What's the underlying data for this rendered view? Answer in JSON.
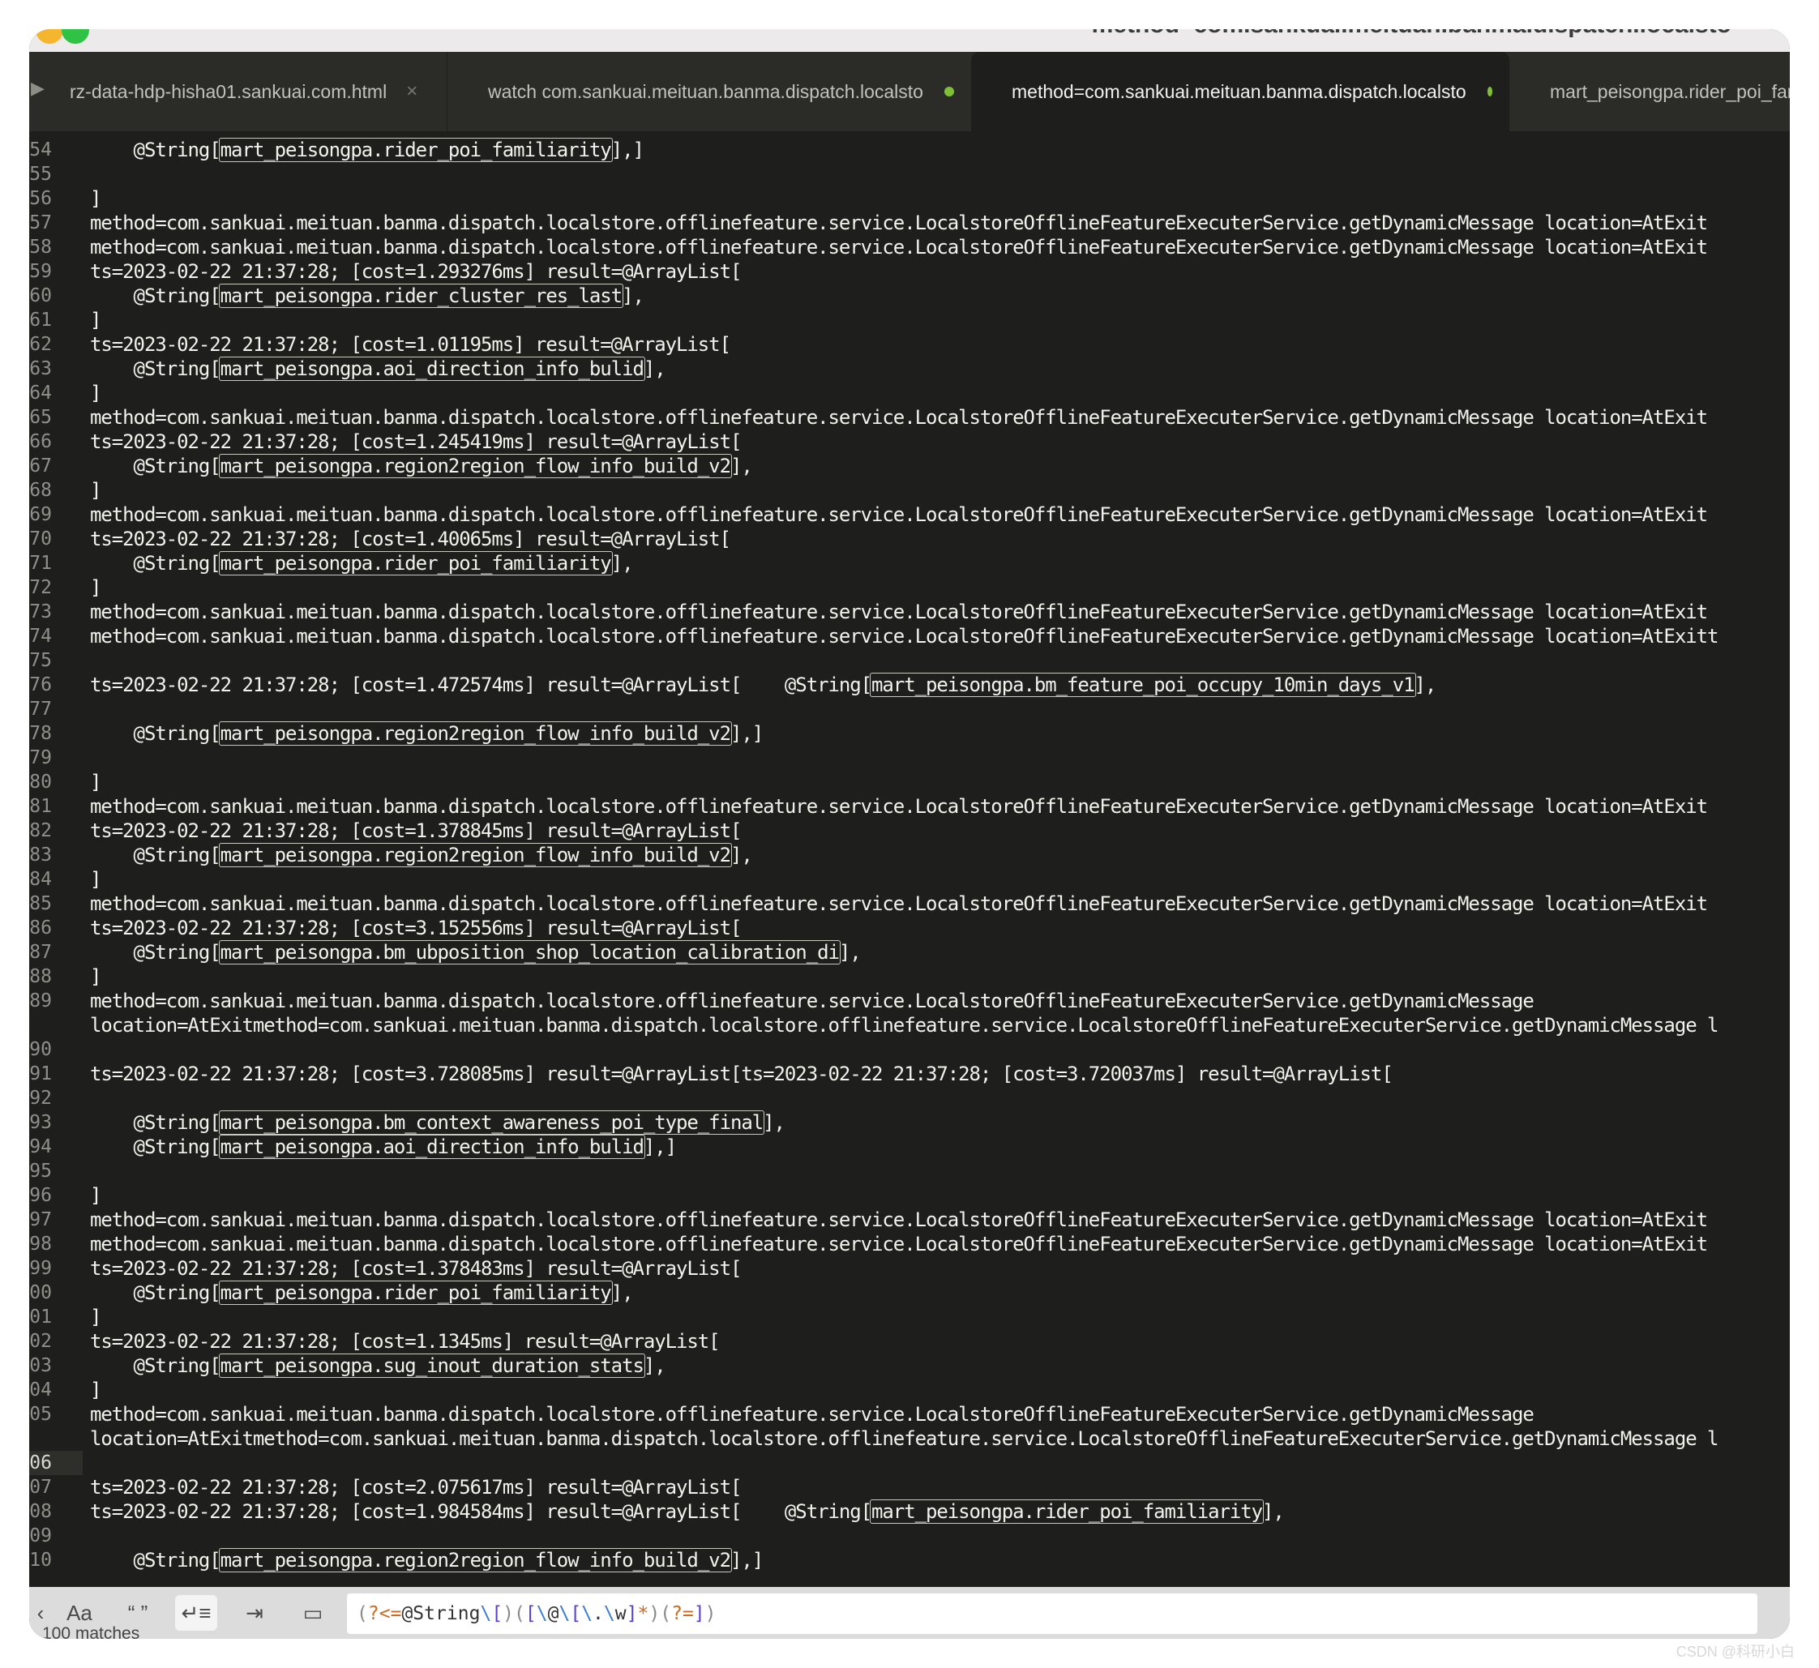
{
  "window_title": "method=com.sankuai.meituan.banma.dispatch.localsto",
  "tabs": [
    {
      "label": "rz-data-hdp-hisha01.sankuai.com.html",
      "active": false,
      "indicator": "close"
    },
    {
      "label": "watch com.sankuai.meituan.banma.dispatch.localsto",
      "active": false,
      "indicator": "dot"
    },
    {
      "label": "method=com.sankuai.meituan.banma.dispatch.localsto",
      "active": true,
      "indicator": "dot"
    },
    {
      "label": "mart_peisongpa.rider_poi_fami",
      "active": false,
      "indicator": "none"
    }
  ],
  "lines": [
    {
      "num": "54",
      "parts": [
        {
          "t": "    @String["
        },
        {
          "t": "mart_peisongpa.rider_poi_familiarity",
          "m": true
        },
        {
          "t": "],]"
        }
      ]
    },
    {
      "num": "55",
      "parts": []
    },
    {
      "num": "56",
      "parts": [
        {
          "t": "]"
        }
      ]
    },
    {
      "num": "57",
      "parts": [
        {
          "t": "method=com.sankuai.meituan.banma.dispatch.localstore.offlinefeature.service.LocalstoreOfflineFeatureExecuterService.getDynamicMessage location=AtExit"
        }
      ]
    },
    {
      "num": "58",
      "parts": [
        {
          "t": "method=com.sankuai.meituan.banma.dispatch.localstore.offlinefeature.service.LocalstoreOfflineFeatureExecuterService.getDynamicMessage location=AtExit"
        }
      ]
    },
    {
      "num": "59",
      "parts": [
        {
          "t": "ts=2023-02-22 21:37:28; [cost=1.293276ms] result=@ArrayList["
        }
      ]
    },
    {
      "num": "60",
      "parts": [
        {
          "t": "    @String["
        },
        {
          "t": "mart_peisongpa.rider_cluster_res_last",
          "m": true
        },
        {
          "t": "],"
        }
      ]
    },
    {
      "num": "61",
      "parts": [
        {
          "t": "]"
        }
      ]
    },
    {
      "num": "62",
      "parts": [
        {
          "t": "ts=2023-02-22 21:37:28; [cost=1.01195ms] result=@ArrayList["
        }
      ]
    },
    {
      "num": "63",
      "parts": [
        {
          "t": "    @String["
        },
        {
          "t": "mart_peisongpa.aoi_direction_info_bulid",
          "m": true
        },
        {
          "t": "],"
        }
      ]
    },
    {
      "num": "64",
      "parts": [
        {
          "t": "]"
        }
      ]
    },
    {
      "num": "65",
      "parts": [
        {
          "t": "method=com.sankuai.meituan.banma.dispatch.localstore.offlinefeature.service.LocalstoreOfflineFeatureExecuterService.getDynamicMessage location=AtExit"
        }
      ]
    },
    {
      "num": "66",
      "parts": [
        {
          "t": "ts=2023-02-22 21:37:28; [cost=1.245419ms] result=@ArrayList["
        }
      ]
    },
    {
      "num": "67",
      "parts": [
        {
          "t": "    @String["
        },
        {
          "t": "mart_peisongpa.region2region_flow_info_build_v2",
          "m": true
        },
        {
          "t": "],"
        }
      ]
    },
    {
      "num": "68",
      "parts": [
        {
          "t": "]"
        }
      ]
    },
    {
      "num": "69",
      "parts": [
        {
          "t": "method=com.sankuai.meituan.banma.dispatch.localstore.offlinefeature.service.LocalstoreOfflineFeatureExecuterService.getDynamicMessage location=AtExit"
        }
      ]
    },
    {
      "num": "70",
      "parts": [
        {
          "t": "ts=2023-02-22 21:37:28; [cost=1.40065ms] result=@ArrayList["
        }
      ]
    },
    {
      "num": "71",
      "parts": [
        {
          "t": "    @String["
        },
        {
          "t": "mart_peisongpa.rider_poi_familiarity",
          "m": true
        },
        {
          "t": "],"
        }
      ]
    },
    {
      "num": "72",
      "parts": [
        {
          "t": "]"
        }
      ]
    },
    {
      "num": "73",
      "parts": [
        {
          "t": "method=com.sankuai.meituan.banma.dispatch.localstore.offlinefeature.service.LocalstoreOfflineFeatureExecuterService.getDynamicMessage location=AtExit"
        }
      ]
    },
    {
      "num": "74",
      "parts": [
        {
          "t": "method=com.sankuai.meituan.banma.dispatch.localstore.offlinefeature.service.LocalstoreOfflineFeatureExecuterService.getDynamicMessage location=AtExitt"
        }
      ]
    },
    {
      "num": "75",
      "parts": []
    },
    {
      "num": "76",
      "parts": [
        {
          "t": "ts=2023-02-22 21:37:28; [cost=1.472574ms] result=@ArrayList[    @String["
        },
        {
          "t": "mart_peisongpa.bm_feature_poi_occupy_10min_days_v1",
          "m": true
        },
        {
          "t": "],"
        }
      ]
    },
    {
      "num": "77",
      "parts": []
    },
    {
      "num": "78",
      "parts": [
        {
          "t": "    @String["
        },
        {
          "t": "mart_peisongpa.region2region_flow_info_build_v2",
          "m": true
        },
        {
          "t": "],]"
        }
      ]
    },
    {
      "num": "79",
      "parts": []
    },
    {
      "num": "80",
      "parts": [
        {
          "t": "]"
        }
      ]
    },
    {
      "num": "81",
      "parts": [
        {
          "t": "method=com.sankuai.meituan.banma.dispatch.localstore.offlinefeature.service.LocalstoreOfflineFeatureExecuterService.getDynamicMessage location=AtExit"
        }
      ]
    },
    {
      "num": "82",
      "parts": [
        {
          "t": "ts=2023-02-22 21:37:28; [cost=1.378845ms] result=@ArrayList["
        }
      ]
    },
    {
      "num": "83",
      "parts": [
        {
          "t": "    @String["
        },
        {
          "t": "mart_peisongpa.region2region_flow_info_build_v2",
          "m": true
        },
        {
          "t": "],"
        }
      ]
    },
    {
      "num": "84",
      "parts": [
        {
          "t": "]"
        }
      ]
    },
    {
      "num": "85",
      "parts": [
        {
          "t": "method=com.sankuai.meituan.banma.dispatch.localstore.offlinefeature.service.LocalstoreOfflineFeatureExecuterService.getDynamicMessage location=AtExit"
        }
      ]
    },
    {
      "num": "86",
      "parts": [
        {
          "t": "ts=2023-02-22 21:37:28; [cost=3.152556ms] result=@ArrayList["
        }
      ]
    },
    {
      "num": "87",
      "parts": [
        {
          "t": "    @String["
        },
        {
          "t": "mart_peisongpa.bm_ubposition_shop_location_calibration_di",
          "m": true
        },
        {
          "t": "],"
        }
      ]
    },
    {
      "num": "88",
      "parts": [
        {
          "t": "]"
        }
      ]
    },
    {
      "num": "89",
      "parts": [
        {
          "t": "method=com.sankuai.meituan.banma.dispatch.localstore.offlinefeature.service.LocalstoreOfflineFeatureExecuterService.getDynamicMessage"
        }
      ]
    },
    {
      "num": "",
      "parts": [
        {
          "t": "location=AtExitmethod=com.sankuai.meituan.banma.dispatch.localstore.offlinefeature.service.LocalstoreOfflineFeatureExecuterService.getDynamicMessage l"
        }
      ]
    },
    {
      "num": "90",
      "parts": []
    },
    {
      "num": "91",
      "parts": [
        {
          "t": "ts=2023-02-22 21:37:28; [cost=3.728085ms] result=@ArrayList[ts=2023-02-22 21:37:28; [cost=3.720037ms] result=@ArrayList["
        }
      ]
    },
    {
      "num": "92",
      "parts": []
    },
    {
      "num": "93",
      "parts": [
        {
          "t": "    @String["
        },
        {
          "t": "mart_peisongpa.bm_context_awareness_poi_type_final",
          "m": true
        },
        {
          "t": "],"
        }
      ]
    },
    {
      "num": "94",
      "parts": [
        {
          "t": "    @String["
        },
        {
          "t": "mart_peisongpa.aoi_direction_info_bulid",
          "m": true
        },
        {
          "t": "],]"
        }
      ]
    },
    {
      "num": "95",
      "parts": []
    },
    {
      "num": "96",
      "parts": [
        {
          "t": "]"
        }
      ]
    },
    {
      "num": "97",
      "parts": [
        {
          "t": "method=com.sankuai.meituan.banma.dispatch.localstore.offlinefeature.service.LocalstoreOfflineFeatureExecuterService.getDynamicMessage location=AtExit"
        }
      ]
    },
    {
      "num": "98",
      "parts": [
        {
          "t": "method=com.sankuai.meituan.banma.dispatch.localstore.offlinefeature.service.LocalstoreOfflineFeatureExecuterService.getDynamicMessage location=AtExit"
        }
      ]
    },
    {
      "num": "99",
      "parts": [
        {
          "t": "ts=2023-02-22 21:37:28; [cost=1.378483ms] result=@ArrayList["
        }
      ]
    },
    {
      "num": "00",
      "parts": [
        {
          "t": "    @String["
        },
        {
          "t": "mart_peisongpa.rider_poi_familiarity",
          "m": true
        },
        {
          "t": "],"
        }
      ]
    },
    {
      "num": "01",
      "parts": [
        {
          "t": "]"
        }
      ]
    },
    {
      "num": "02",
      "parts": [
        {
          "t": "ts=2023-02-22 21:37:28; [cost=1.1345ms] result=@ArrayList["
        }
      ]
    },
    {
      "num": "03",
      "parts": [
        {
          "t": "    @String["
        },
        {
          "t": "mart_peisongpa.sug_inout_duration_stats",
          "m": true
        },
        {
          "t": "],"
        }
      ]
    },
    {
      "num": "04",
      "parts": [
        {
          "t": "]"
        }
      ]
    },
    {
      "num": "05",
      "parts": [
        {
          "t": "method=com.sankuai.meituan.banma.dispatch.localstore.offlinefeature.service.LocalstoreOfflineFeatureExecuterService.getDynamicMessage"
        }
      ]
    },
    {
      "num": "",
      "parts": [
        {
          "t": "location=AtExitmethod=com.sankuai.meituan.banma.dispatch.localstore.offlinefeature.service.LocalstoreOfflineFeatureExecuterService.getDynamicMessage l"
        }
      ]
    },
    {
      "num": "06",
      "parts": [],
      "current": true
    },
    {
      "num": "07",
      "parts": [
        {
          "t": "ts=2023-02-22 21:37:28; [cost=2.075617ms] result=@ArrayList["
        }
      ]
    },
    {
      "num": "08",
      "parts": [
        {
          "t": "ts=2023-02-22 21:37:28; [cost=1.984584ms] result=@ArrayList[    @String["
        },
        {
          "t": "mart_peisongpa.rider_poi_familiarity",
          "m": true
        },
        {
          "t": "],"
        }
      ]
    },
    {
      "num": "09",
      "parts": []
    },
    {
      "num": "10",
      "parts": [
        {
          "t": "    @String["
        },
        {
          "t": "mart_peisongpa.region2region_flow_info_build_v2",
          "m": true
        },
        {
          "t": "],]"
        }
      ]
    }
  ],
  "find": {
    "case_label": "Aa",
    "word_label": "“ ”",
    "wrap_label": "↵≡",
    "selection_label": "⇥",
    "highlight_label": "▭",
    "prev_label": "‹",
    "query": "(?<=@String\\[)([\\@\\[\\.\\w]*)(?=])",
    "status": "100 matches"
  },
  "watermark": "CSDN @科研小白"
}
